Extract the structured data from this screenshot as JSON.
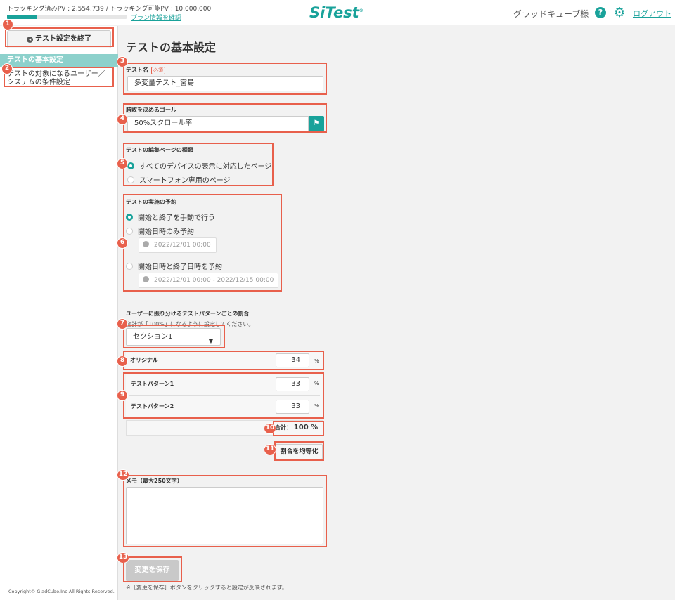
{
  "header": {
    "pv_tracked_label": "トラッキング済みPV : 2,554,739",
    "pv_separator": " / ",
    "pv_available_label": "トラッキング可能PV : 10,000,000",
    "pv_usage_ratio": 0.255,
    "plan_link": "プラン情報を確認",
    "logo": "SiTest",
    "user_name": "グラッドキューブ様",
    "help_glyph": "?",
    "logout": "ログアウト"
  },
  "sidebar": {
    "end_button": "テスト設定を終了",
    "active_item": "テストの基本設定",
    "item_conditions": "テストの対象になるユーザー／システムの条件設定",
    "copyright": "Copyright© GladCube.Inc All Rights Reserved."
  },
  "main": {
    "page_title": "テストの基本設定",
    "test_name": {
      "label": "テスト名",
      "required": "必須",
      "value": "多変量テスト_宮島"
    },
    "goal": {
      "label": "勝敗を決めるゴール",
      "value": "50%スクロール率"
    },
    "page_type": {
      "label": "テストの編集ページの種類",
      "options": [
        "すべてのデバイスの表示に対応したページ",
        "スマートフォン専用のページ"
      ],
      "selected_index": 0
    },
    "schedule": {
      "label": "テストの実施の予約",
      "opt_manual": "開始と終了を手動で行う",
      "opt_start_only": "開始日時のみ予約",
      "start_date": "2022/12/01 00:00",
      "opt_start_end": "開始日時と終了日時を予約",
      "range_date": "2022/12/01 00:00 - 2022/12/15 00:00",
      "selected_index": 0
    },
    "ratio": {
      "label": "ユーザーに振り分けるテストパターンごとの割合",
      "note": "合計が「100%」になるように設定してください。",
      "section_select": "セクション1",
      "original": {
        "name": "オリジナル",
        "value": "34"
      },
      "patterns": [
        {
          "name": "テストパターン1",
          "value": "33"
        },
        {
          "name": "テストパターン2",
          "value": "33"
        }
      ],
      "unit": "%",
      "total_label": "合計：",
      "total_value": "100 %",
      "equalize_button": "割合を均等化"
    },
    "memo": {
      "label": "メモ（最大250文字）",
      "value": ""
    },
    "save_button": "変更を保存",
    "save_note": "※［変更を保存］ボタンをクリックすると設定が反映されます。"
  },
  "markers": [
    "1",
    "2",
    "3",
    "4",
    "5",
    "6",
    "7",
    "8",
    "9",
    "10",
    "11",
    "12",
    "13"
  ],
  "colors": {
    "accent": "#19a29a",
    "marker": "#e8604c",
    "sidebar_active": "#8dd1cc"
  }
}
